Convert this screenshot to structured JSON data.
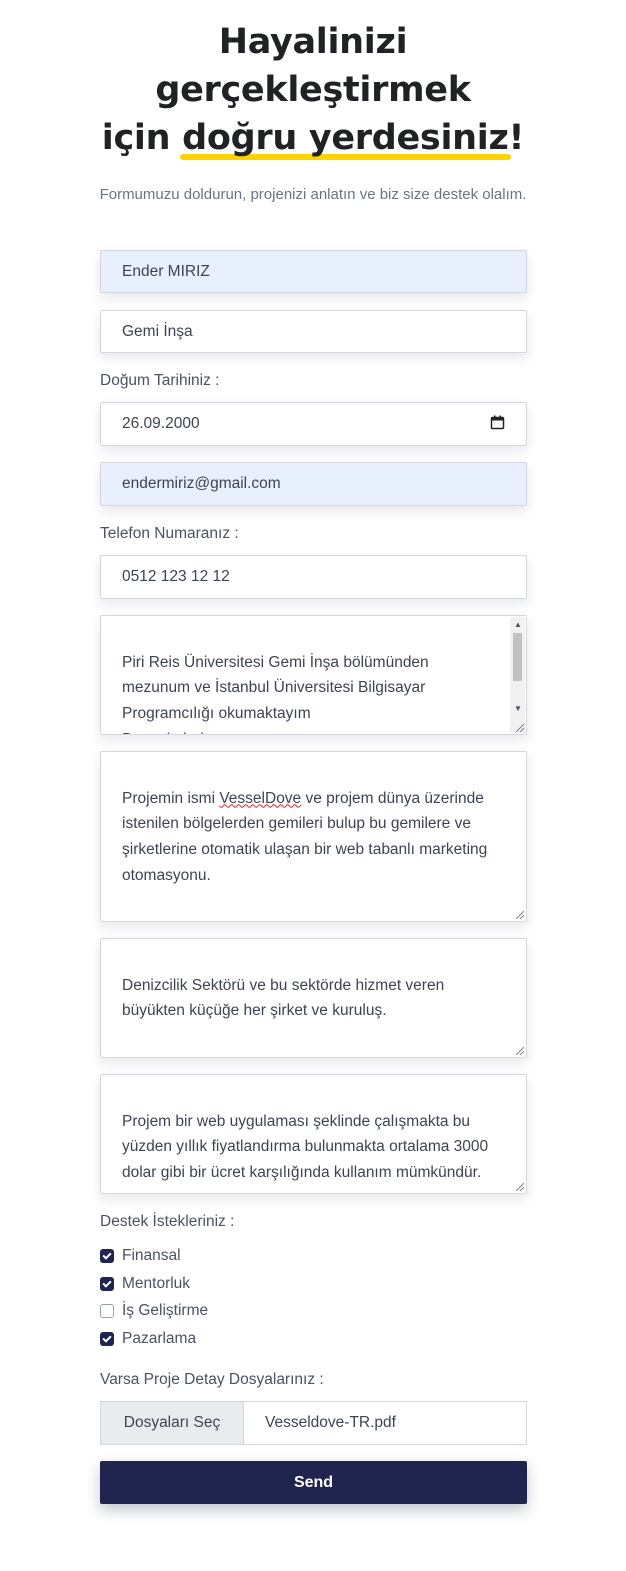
{
  "heading": {
    "line1": "Hayalinizi",
    "line2": "gerçekleştirmek",
    "line3_prefix": "için ",
    "line3_highlight": "doğru yerdesiniz",
    "line3_suffix": "!"
  },
  "subtitle": "Formumuzu doldurun, projenizi anlatın ve biz size destek olalım.",
  "form": {
    "name_value": "Ender MIRIZ",
    "department_value": "Gemi İnşa",
    "birthdate_label": "Doğum Tarihiniz :",
    "birthdate_value": "26.09.2000",
    "email_value": "endermiriz@gmail.com",
    "phone_label": "Telefon Numaranız :",
    "phone_value": "0512 123 12 12",
    "about_text": "Piri Reis Üniversitesi Gemi İnşa bölümünden mezunum ve İstanbul Üniversitesi Bilgisayar Programcılığı okumaktayım\nDeneyimlerim:",
    "project_text_before": "Projemin ismi ",
    "project_text_name": "VesselDove",
    "project_text_after": " ve projem dünya üzerinde istenilen bölgelerden gemileri bulup bu gemilere ve şirketlerine otomatik ulaşan bir web tabanlı marketing otomasyonu.",
    "target_text": "Denizcilik Sektörü ve bu sektörde hizmet veren büyükten küçüğe her şirket ve kuruluş.",
    "pricing_text": "Projem bir web uygulaması şeklinde çalışmakta bu yüzden yıllık fiyatlandırma bulunmakta ortalama 3000 dolar gibi bir ücret karşılığında kullanım mümkündür.",
    "support_label": "Destek İstekleriniz :",
    "support_options": [
      {
        "label": "Finansal",
        "checked": true
      },
      {
        "label": "Mentorluk",
        "checked": true
      },
      {
        "label": "İş Geliştirme",
        "checked": false
      },
      {
        "label": "Pazarlama",
        "checked": true
      }
    ],
    "file_label": "Varsa Proje Detay Dosyalarınız :",
    "file_button": "Dosyaları Seç",
    "file_name": "Vesseldove-TR.pdf",
    "send_label": "Send"
  },
  "icons": {
    "date_picker": "calendar-icon",
    "checkbox_checked": "checkmark-icon"
  },
  "colors": {
    "accent": "#20254f",
    "highlight": "#ffd200",
    "autofill_bg": "#e8f0fe"
  }
}
